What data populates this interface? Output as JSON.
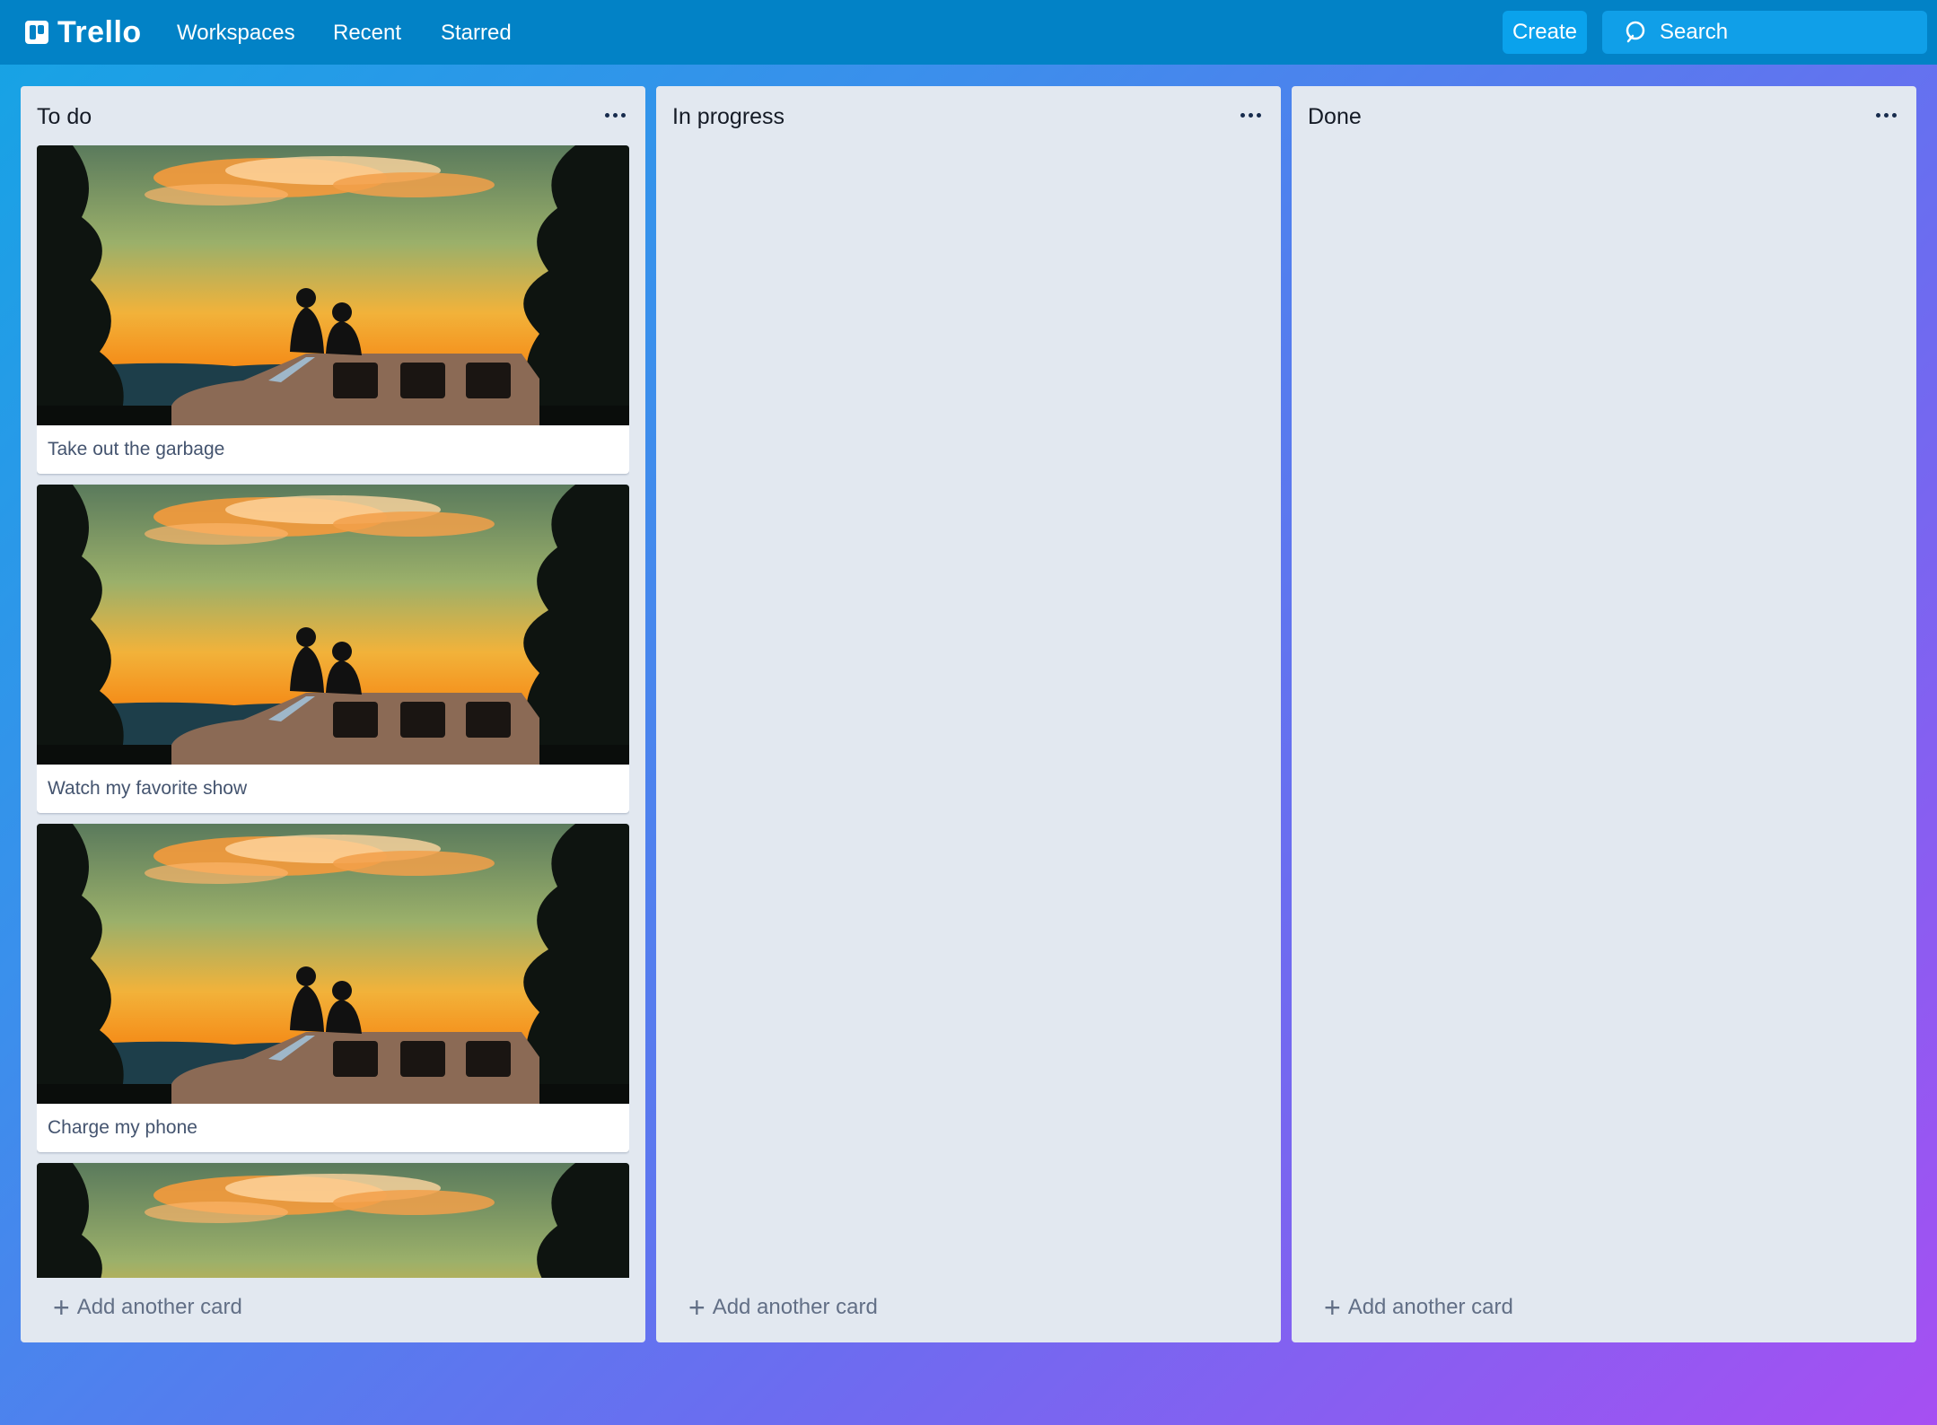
{
  "app": {
    "logo_text": "Trello",
    "nav": [
      "Workspaces",
      "Recent",
      "Starred"
    ],
    "create_label": "Create",
    "search_placeholder": "Search",
    "colors": {
      "topbar": "#0282c6",
      "list_bg": "#e2e8f0",
      "gradient_start": "#15a4e4",
      "gradient_end": "#a64ff2"
    }
  },
  "lists": [
    {
      "title": "To do",
      "cards": [
        {
          "title": "Take out the garbage",
          "cover": "sunset-jeep-image"
        },
        {
          "title": "Watch my favorite show",
          "cover": "sunset-jeep-image"
        },
        {
          "title": "Charge my phone",
          "cover": "sunset-jeep-image"
        },
        {
          "title": "",
          "cover": "sunset-jeep-image"
        }
      ],
      "add_card_label": "Add another card"
    },
    {
      "title": "In progress",
      "cards": [],
      "add_card_label": "Add another card"
    },
    {
      "title": "Done",
      "cards": [],
      "add_card_label": "Add another card"
    }
  ],
  "icons": {
    "list_menu": "ellipsis-icon",
    "search": "search-icon",
    "add": "plus-icon"
  }
}
